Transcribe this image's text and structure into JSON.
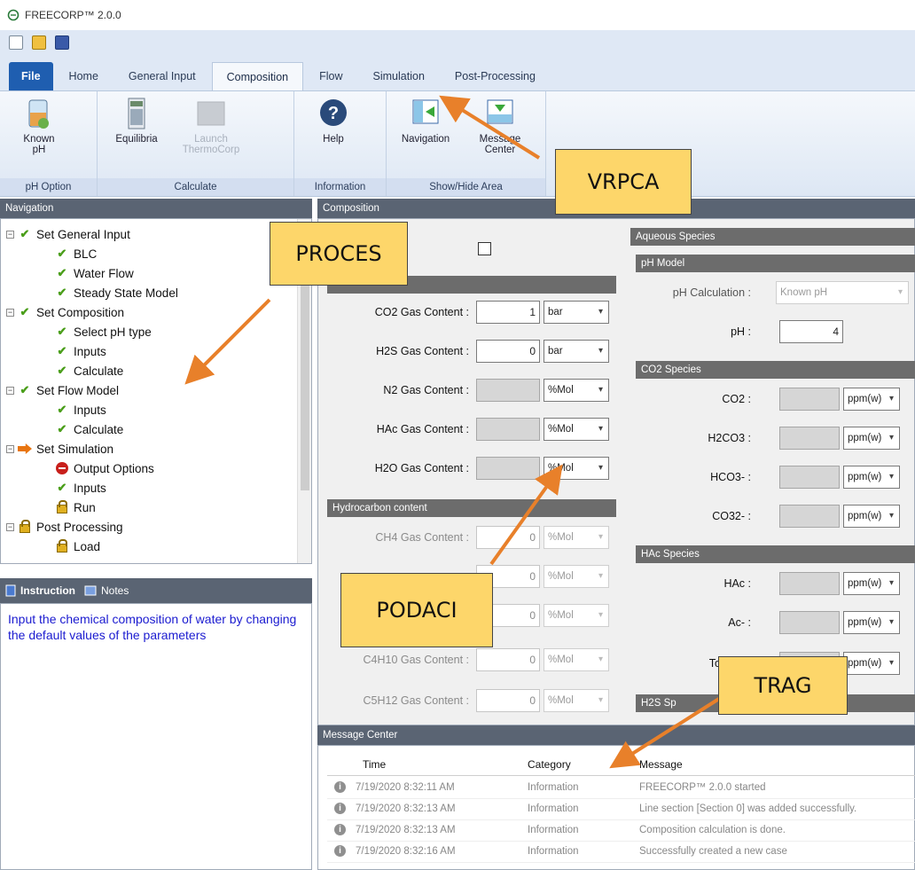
{
  "window": {
    "title": "FREECORP™ 2.0.0"
  },
  "ribbon_tabs": [
    "File",
    "Home",
    "General Input",
    "Composition",
    "Flow",
    "Simulation",
    "Post-Processing"
  ],
  "ribbon": {
    "groups": [
      {
        "label": "pH Option",
        "buttons": [
          {
            "line1": "Known",
            "line2": "pH"
          }
        ]
      },
      {
        "label": "Calculate",
        "buttons": [
          {
            "line1": "Equilibria",
            "line2": ""
          },
          {
            "line1": "Launch",
            "line2": "ThermoCorp"
          }
        ]
      },
      {
        "label": "Information",
        "buttons": [
          {
            "line1": "Help",
            "line2": ""
          }
        ]
      },
      {
        "label": "Show/Hide Area",
        "buttons": [
          {
            "line1": "Navigation",
            "line2": ""
          },
          {
            "line1": "Message",
            "line2": "Center"
          }
        ]
      }
    ]
  },
  "navigation": {
    "header": "Navigation",
    "items": [
      "Set General Input",
      "BLC",
      "Water Flow",
      "Steady State Model",
      "Set Composition",
      "Select pH type",
      "Inputs",
      "Calculate",
      "Set Flow Model",
      "Inputs",
      "Calculate",
      "Set Simulation",
      "Output Options",
      "Inputs",
      "Run",
      "Post Processing",
      "Load"
    ]
  },
  "instruction": {
    "tab_instruction": "Instruction",
    "tab_notes": "Notes",
    "text": "Input the chemical composition of water by changing the default values of the parameters"
  },
  "composition": {
    "header": "Composition",
    "gas_fields": [
      {
        "label": "CO2 Gas Content :",
        "value": "1",
        "unit": "bar"
      },
      {
        "label": "H2S Gas Content :",
        "value": "0",
        "unit": "bar"
      },
      {
        "label": "N2 Gas Content :",
        "value": "",
        "unit": "%Mol"
      },
      {
        "label": "HAc Gas Content :",
        "value": "",
        "unit": "%Mol"
      },
      {
        "label": "H2O Gas Content :",
        "value": "",
        "unit": "%Mol"
      }
    ],
    "hydrocarbon_header": "Hydrocarbon content",
    "hydrocarbon_fields": [
      {
        "label": "CH4 Gas Content :",
        "value": "0",
        "unit": "%Mol"
      },
      {
        "label": "",
        "value": "0",
        "unit": "%Mol"
      },
      {
        "label": "",
        "value": "0",
        "unit": "%Mol"
      },
      {
        "label": "C4H10 Gas Content :",
        "value": "0",
        "unit": "%Mol"
      },
      {
        "label": "C5H12 Gas Content :",
        "value": "0",
        "unit": "%Mol"
      }
    ],
    "aqueous_header": "Aqueous Species",
    "ph_model_header": "pH Model",
    "ph_calc_label": "pH Calculation :",
    "ph_calc_value": "Known pH",
    "ph_label": "pH :",
    "ph_value": "4",
    "co2_header": "CO2 Species",
    "co2_fields": [
      {
        "label": "CO2 :",
        "unit": "ppm(w)"
      },
      {
        "label": "H2CO3 :",
        "unit": "ppm(w)"
      },
      {
        "label": "HCO3- :",
        "unit": "ppm(w)"
      },
      {
        "label": "CO32- :",
        "unit": "ppm(w)"
      }
    ],
    "hac_header": "HAc Species",
    "hac_fields": [
      {
        "label": "HAc :",
        "unit": "ppm(w)"
      },
      {
        "label": "Ac- :",
        "unit": "ppm(w)"
      },
      {
        "label": "Total HA",
        "unit": "ppm(w)"
      }
    ],
    "h2s_header": "H2S Sp"
  },
  "message_center": {
    "header": "Message Center",
    "columns": [
      "Time",
      "Category",
      "Message"
    ],
    "rows": [
      {
        "time": "7/19/2020 8:32:11 AM",
        "category": "Information",
        "message": "FREECORP™ 2.0.0 started"
      },
      {
        "time": "7/19/2020 8:32:13 AM",
        "category": "Information",
        "message": "Line section [Section 0] was added successfully."
      },
      {
        "time": "7/19/2020 8:32:13 AM",
        "category": "Information",
        "message": "Composition calculation is done."
      },
      {
        "time": "7/19/2020 8:32:16 AM",
        "category": "Information",
        "message": "Successfully created a new case"
      }
    ]
  },
  "callouts": {
    "vrpca": "VRPCA",
    "proces": "PROCES",
    "podaci": "PODACI",
    "trag": "TRAG"
  },
  "colors": {
    "callout_fill": "#fdd66a",
    "arrow": "#e8802a",
    "instruction_text": "#1b1bd0"
  }
}
